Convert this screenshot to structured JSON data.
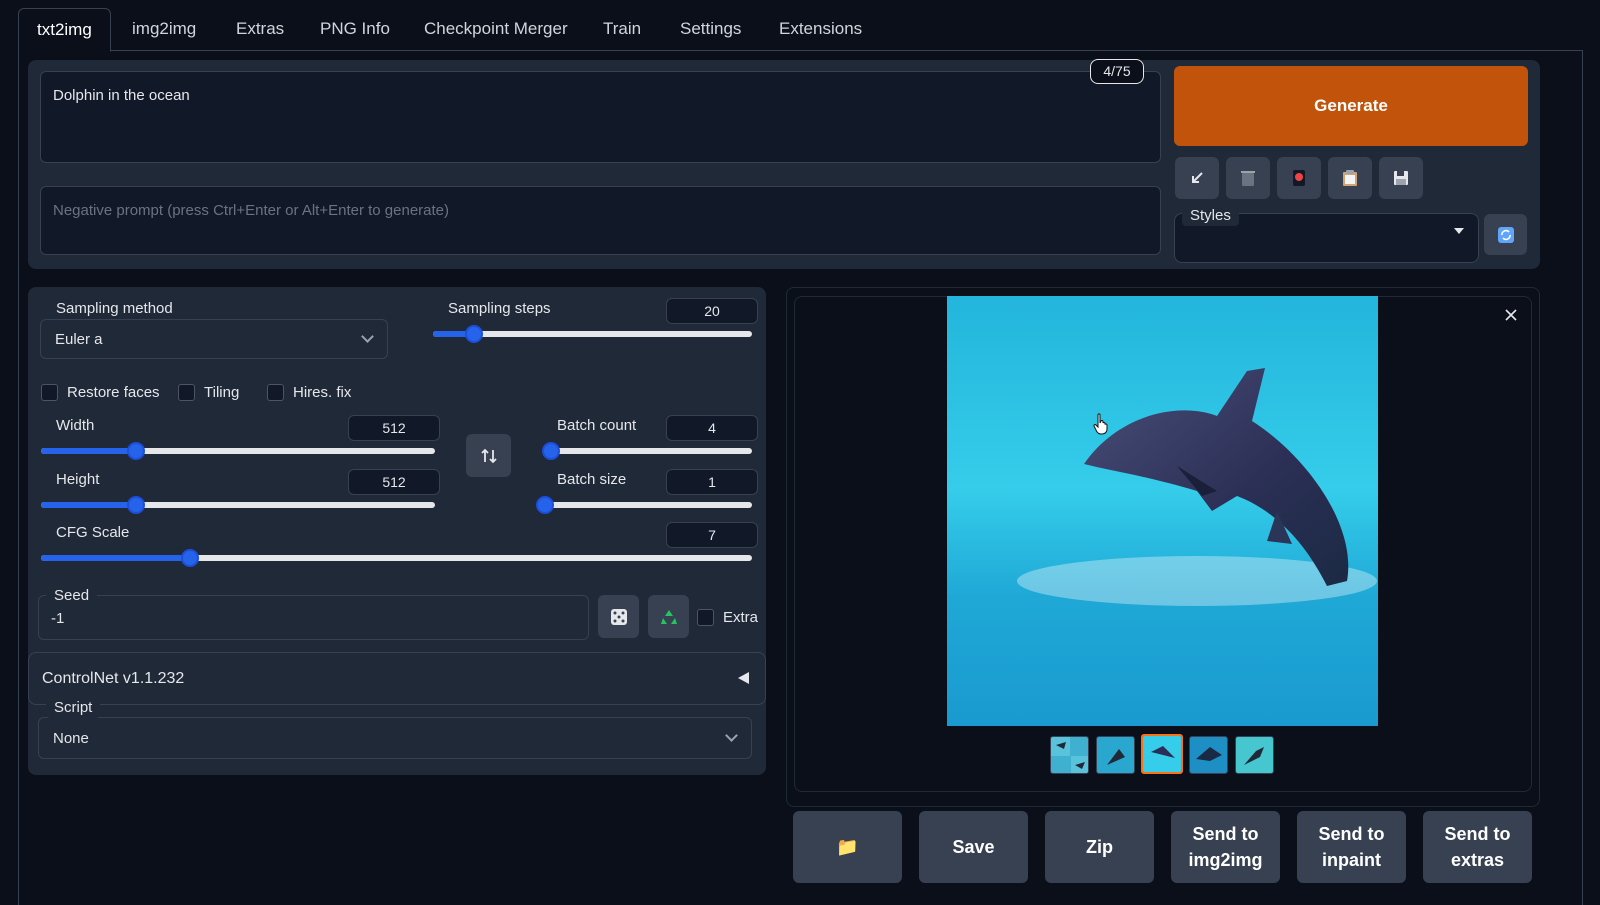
{
  "tabs": [
    "txt2img",
    "img2img",
    "Extras",
    "PNG Info",
    "Checkpoint Merger",
    "Train",
    "Settings",
    "Extensions"
  ],
  "prompt": {
    "value": "Dolphin in the ocean",
    "token_count": "4/75"
  },
  "negative_prompt": {
    "placeholder": "Negative prompt (press Ctrl+Enter or Alt+Enter to generate)"
  },
  "generate_label": "Generate",
  "tool_icons": [
    "arrow-icon",
    "trash-icon",
    "red-button-icon",
    "clipboard-icon",
    "floppy-disk-icon"
  ],
  "styles": {
    "label": "Styles",
    "value": ""
  },
  "sampling": {
    "method_label": "Sampling method",
    "method_value": "Euler a",
    "steps_label": "Sampling steps",
    "steps_value": "20",
    "steps_fraction": 0.13
  },
  "checkboxes": {
    "restore_faces": "Restore faces",
    "tiling": "Tiling",
    "hires_fix": "Hires. fix"
  },
  "width": {
    "label": "Width",
    "value": "512",
    "fraction": 0.24
  },
  "height": {
    "label": "Height",
    "value": "512",
    "fraction": 0.24
  },
  "batch_count": {
    "label": "Batch count",
    "value": "4",
    "fraction": 0.03
  },
  "batch_size": {
    "label": "Batch size",
    "value": "1",
    "fraction": 0.0
  },
  "cfg": {
    "label": "CFG Scale",
    "value": "7",
    "fraction": 0.21
  },
  "seed": {
    "label": "Seed",
    "value": "-1",
    "extra_label": "Extra"
  },
  "controlnet": {
    "label": "ControlNet v1.1.232"
  },
  "script": {
    "label": "Script",
    "value": "None"
  },
  "output_buttons": {
    "folder": "📁",
    "save": "Save",
    "zip": "Zip",
    "send_img2img": "Send to img2img",
    "send_inpaint": "Send to inpaint",
    "send_extras": "Send to extras"
  },
  "colors": {
    "accent": "#2563eb",
    "generate": "#c2530a",
    "selected_thumb": "#f97316"
  }
}
